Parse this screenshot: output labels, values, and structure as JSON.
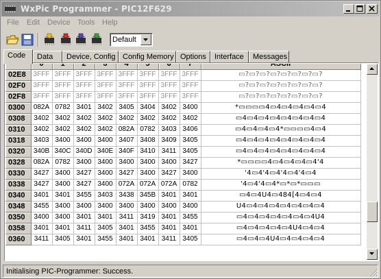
{
  "window": {
    "title": "WxPic Programmer - PIC12F629"
  },
  "menu": [
    "File",
    "Edit",
    "Device",
    "Tools",
    "Help"
  ],
  "toolbar": {
    "buttons": [
      "open-file-icon",
      "save-file-icon",
      "program-chip-icon",
      "read-chip-icon",
      "verify-chip-icon",
      "erase-chip-icon"
    ],
    "config_value": "Default"
  },
  "tabs": [
    "Code",
    "Data",
    "Device, Config",
    "Config Memory",
    "Options",
    "Interface",
    "Messages"
  ],
  "grid": {
    "columns": [
      "0",
      "1",
      "2",
      "3",
      "4",
      "5",
      "6",
      "7",
      "ASCII"
    ],
    "rows": [
      {
        "addr": "02E8",
        "cells": [
          "3FFF",
          "3FFF",
          "3FFF",
          "3FFF",
          "3FFF",
          "3FFF",
          "3FFF",
          "3FFF"
        ],
        "ascii": "▭?▭?▭?▭?▭?▭?▭?▭?",
        "blank": true
      },
      {
        "addr": "02F0",
        "cells": [
          "3FFF",
          "3FFF",
          "3FFF",
          "3FFF",
          "3FFF",
          "3FFF",
          "3FFF",
          "3FFF"
        ],
        "ascii": "▭?▭?▭?▭?▭?▭?▭?▭?",
        "blank": true
      },
      {
        "addr": "02F8",
        "cells": [
          "3FFF",
          "3FFF",
          "3FFF",
          "3FFF",
          "3FFF",
          "3FFF",
          "3FFF",
          "3FFF"
        ],
        "ascii": "▭?▭?▭?▭?▭?▭?▭?▭?",
        "blank": true
      },
      {
        "addr": "0300",
        "cells": [
          "082A",
          "0782",
          "3401",
          "3402",
          "3405",
          "3404",
          "3402",
          "3400"
        ],
        "ascii": "*▭▭▭▭4▭4▭4▭4▭4▭4",
        "blank": false
      },
      {
        "addr": "0308",
        "cells": [
          "3402",
          "3402",
          "3402",
          "3402",
          "3402",
          "3402",
          "3402",
          "3402"
        ],
        "ascii": "▭4▭4▭4▭4▭4▭4▭4▭4",
        "blank": false
      },
      {
        "addr": "0310",
        "cells": [
          "3402",
          "3402",
          "3402",
          "3402",
          "082A",
          "0782",
          "3403",
          "3406"
        ],
        "ascii": "▭4▭4▭4▭4*▭▭▭▭4▭4",
        "blank": false
      },
      {
        "addr": "0318",
        "cells": [
          "3403",
          "3400",
          "3400",
          "3400",
          "3407",
          "3408",
          "3409",
          "3405"
        ],
        "ascii": "▭4▭4▭4▭4▭4▭4▭4▭4",
        "blank": false
      },
      {
        "addr": "0320",
        "cells": [
          "340B",
          "340C",
          "340D",
          "340E",
          "340F",
          "3410",
          "3411",
          "3405"
        ],
        "ascii": "▭4▭4▭4▭4▭4▭4▭4▭4",
        "blank": false
      },
      {
        "addr": "0328",
        "cells": [
          "082A",
          "0782",
          "3400",
          "3400",
          "3400",
          "3400",
          "3400",
          "3427"
        ],
        "ascii": "*▭▭▭▭4▭4▭4▭4▭4'4",
        "blank": false
      },
      {
        "addr": "0330",
        "cells": [
          "3427",
          "3400",
          "3427",
          "3400",
          "3427",
          "3400",
          "3427",
          "3400"
        ],
        "ascii": "'4▭4'4▭4'4▭4'4▭4",
        "blank": false
      },
      {
        "addr": "0338",
        "cells": [
          "3427",
          "3400",
          "3427",
          "3400",
          "072A",
          "072A",
          "072A",
          "0782"
        ],
        "ascii": "'4▭4'4▭4*▭*▭*▭▭▭",
        "blank": false
      },
      {
        "addr": "0340",
        "cells": [
          "3401",
          "3401",
          "3455",
          "3403",
          "3438",
          "345B",
          "3401",
          "3401"
        ],
        "ascii": "▭4▭4U4▭484[4▭4▭4",
        "blank": false
      },
      {
        "addr": "0348",
        "cells": [
          "3455",
          "3400",
          "3400",
          "3400",
          "3400",
          "3400",
          "3400",
          "3400"
        ],
        "ascii": "U4▭4▭4▭4▭4▭4▭4▭4",
        "blank": false
      },
      {
        "addr": "0350",
        "cells": [
          "3400",
          "3400",
          "3401",
          "3401",
          "3411",
          "3419",
          "3401",
          "3455"
        ],
        "ascii": "▭4▭4▭4▭4▭4▭4▭4U4",
        "blank": false
      },
      {
        "addr": "0358",
        "cells": [
          "3401",
          "3401",
          "3411",
          "3405",
          "3401",
          "3455",
          "3401",
          "3401"
        ],
        "ascii": "▭4▭4▭4▭4▭4U4▭4▭4",
        "blank": false
      },
      {
        "addr": "0360",
        "cells": [
          "3411",
          "3405",
          "3401",
          "3455",
          "3401",
          "3401",
          "3411",
          "3405"
        ],
        "ascii": "▭4▭4▭4U4▭4▭4▭4▭4",
        "blank": false
      }
    ]
  },
  "status": {
    "message": "Initialising PIC-Programmer: Success."
  }
}
